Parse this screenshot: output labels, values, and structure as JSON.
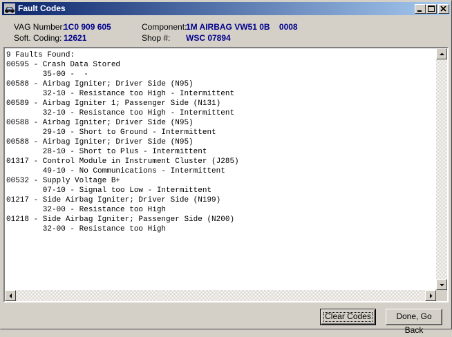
{
  "window": {
    "title": "Fault Codes",
    "icons": {
      "app": "vcds-car-icon",
      "minimize": "minimize-icon",
      "maximize": "maximize-icon",
      "close": "close-icon"
    }
  },
  "header": {
    "vag_number_label": "VAG Number:",
    "vag_number_value": "1C0 909 605",
    "soft_coding_label": "Soft. Coding:",
    "soft_coding_value": "12621",
    "component_label": "Component:",
    "component_value": "1M AIRBAG VW51 0B    0008",
    "shop_label": "Shop #:",
    "shop_value": "WSC 07894"
  },
  "faults": {
    "lines": [
      "9 Faults Found:",
      "00595 - Crash Data Stored",
      "        35-00 -  -",
      "00588 - Airbag Igniter; Driver Side (N95)",
      "        32-10 - Resistance too High - Intermittent",
      "00589 - Airbag Igniter 1; Passenger Side (N131)",
      "        32-10 - Resistance too High - Intermittent",
      "00588 - Airbag Igniter; Driver Side (N95)",
      "        29-10 - Short to Ground - Intermittent",
      "00588 - Airbag Igniter; Driver Side (N95)",
      "        28-10 - Short to Plus - Intermittent",
      "01317 - Control Module in Instrument Cluster (J285)",
      "        49-10 - No Communications - Intermittent",
      "00532 - Supply Voltage B+",
      "        07-10 - Signal too Low - Intermittent",
      "01217 - Side Airbag Igniter; Driver Side (N199)",
      "        32-00 - Resistance too High",
      "01218 - Side Airbag Igniter; Passenger Side (N200)",
      "        32-00 - Resistance too High"
    ]
  },
  "scrollbars": {
    "icons": {
      "up": "scroll-up-arrow-icon",
      "down": "scroll-down-arrow-icon",
      "left": "scroll-left-arrow-icon",
      "right": "scroll-right-arrow-icon"
    }
  },
  "buttons": {
    "clear_codes": "Clear Codes",
    "done_go_back": "Done, Go Back"
  },
  "colors": {
    "title_gradient_start": "#0a246a",
    "title_gradient_end": "#a6caf0",
    "value_text": "#00008b",
    "face": "#d4d0c8"
  }
}
